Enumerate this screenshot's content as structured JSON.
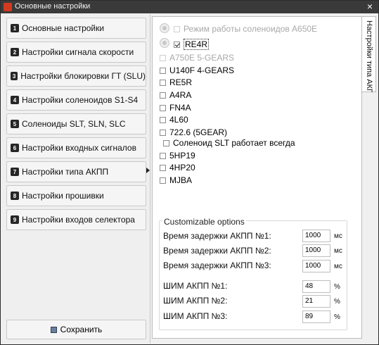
{
  "window": {
    "title": "Основные настройки",
    "close_label": "×"
  },
  "nav": {
    "items": [
      {
        "num": "1",
        "label": "Основные настройки"
      },
      {
        "num": "2",
        "label": "Настройки сигнала скорости"
      },
      {
        "num": "3",
        "label": "Настройки блокировки ГТ (SLU)"
      },
      {
        "num": "4",
        "label": "Настройки соленоидов S1-S4"
      },
      {
        "num": "5",
        "label": "Соленоиды SLT, SLN, SLC"
      },
      {
        "num": "6",
        "label": "Настройки входных сигналов"
      },
      {
        "num": "7",
        "label": "Настройки типа АКПП"
      },
      {
        "num": "8",
        "label": "Настройки прошивки"
      },
      {
        "num": "9",
        "label": "Настройки входов селектора"
      }
    ],
    "save_label": "Сохранить"
  },
  "side_tab": {
    "label": "Настройки типа АКПП"
  },
  "options": {
    "a650e_label": "Режим работы соленоидов A650E",
    "re4r_label": "RE4R",
    "types": [
      "A750E 5-GEARS",
      "U140F 4-GEARS",
      "RE5R",
      "A4RA",
      "FN4A",
      "4L60",
      "722.6 (5GEAR)"
    ],
    "slt_always_label": "Соленоид SLT работает всегда",
    "types2": [
      "5HP19",
      "4HP20",
      "MJBA"
    ]
  },
  "custom": {
    "title": "Customizable options",
    "delays": [
      {
        "label": "Время задержки АКПП №1:",
        "value": "1000",
        "unit": "мс"
      },
      {
        "label": "Время задержки АКПП №2:",
        "value": "1000",
        "unit": "мс"
      },
      {
        "label": "Время задержки АКПП №3:",
        "value": "1000",
        "unit": "мс"
      }
    ],
    "pwm": [
      {
        "label": "ШИМ АКПП №1:",
        "value": "48",
        "unit": "%"
      },
      {
        "label": "ШИМ АКПП №2:",
        "value": "21",
        "unit": "%"
      },
      {
        "label": "ШИМ АКПП №3:",
        "value": "89",
        "unit": "%"
      }
    ]
  }
}
